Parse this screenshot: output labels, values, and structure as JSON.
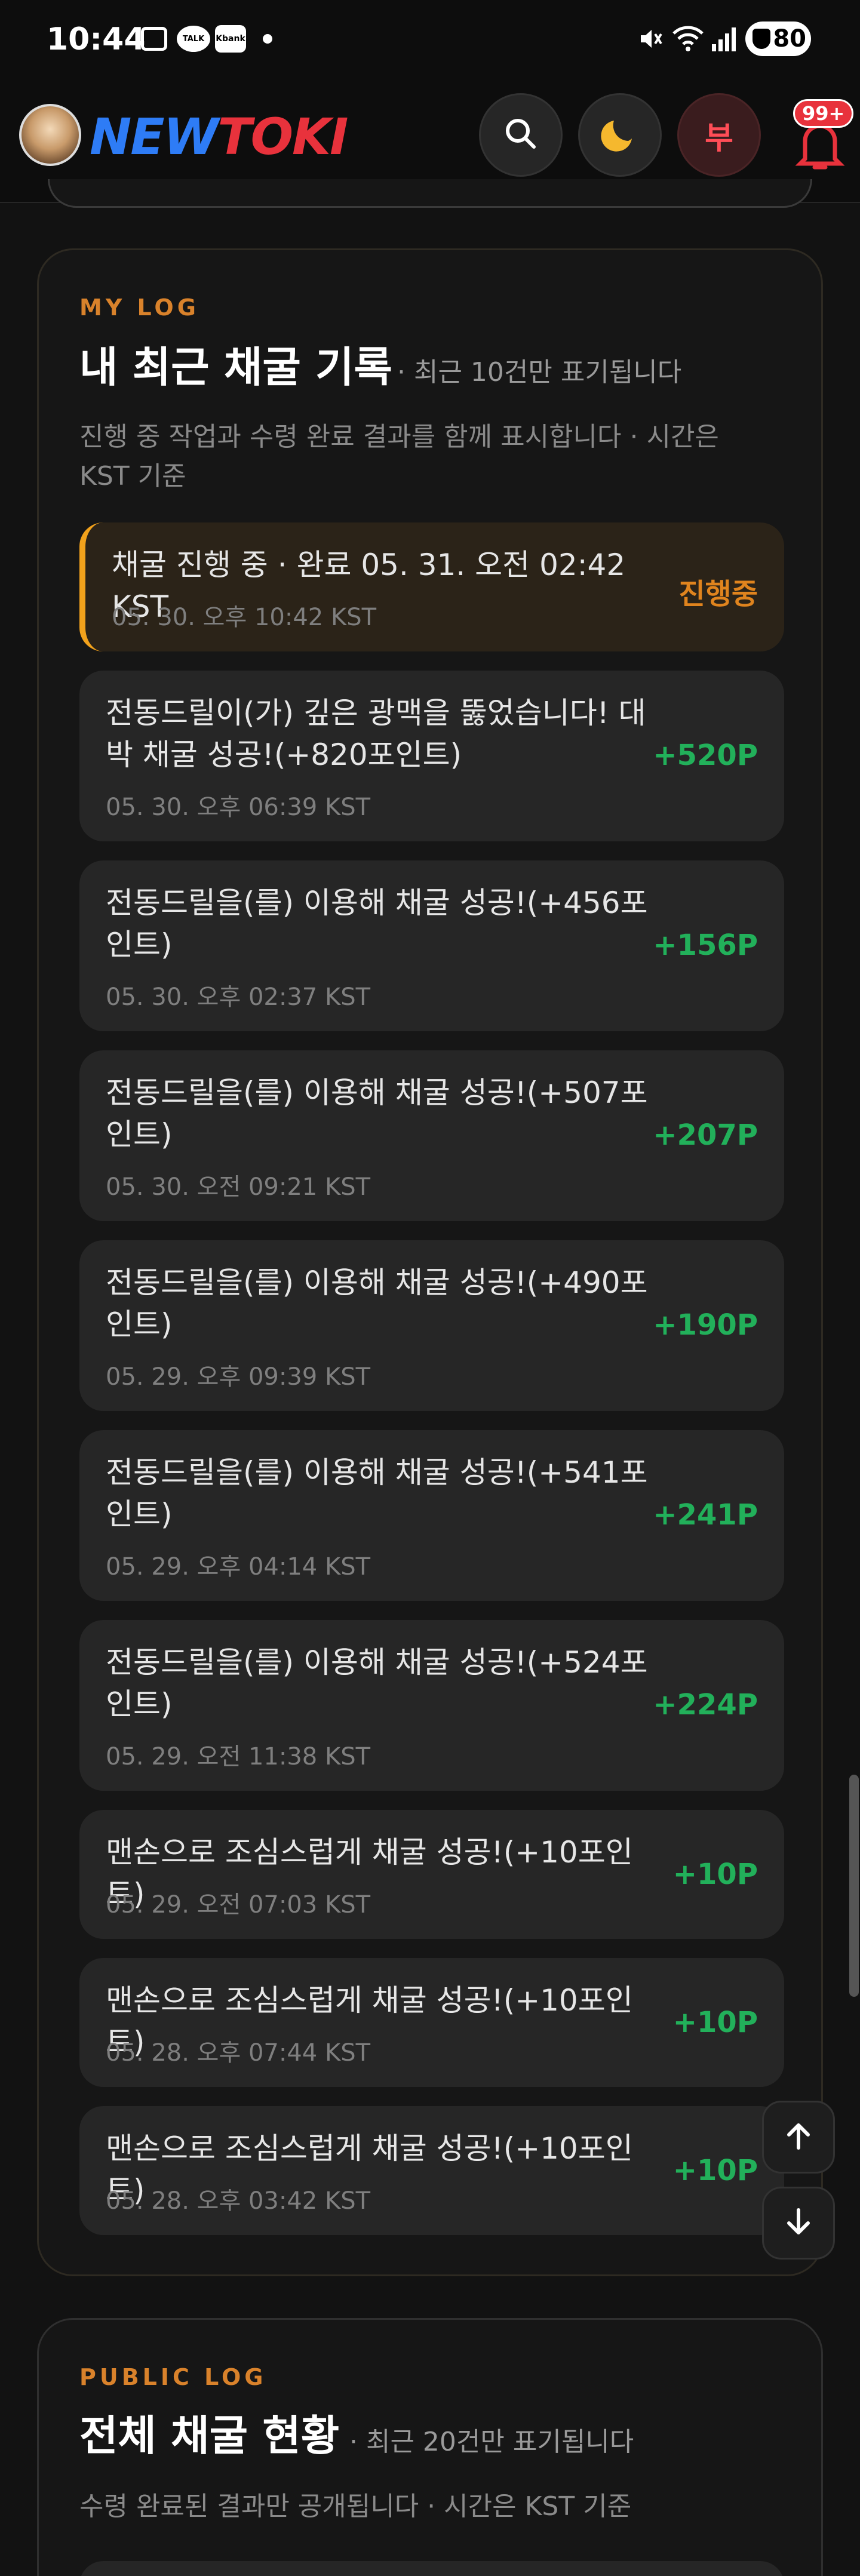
{
  "status_bar": {
    "time": "10:44",
    "icons": [
      "screenshot-icon",
      "talk-icon",
      "kbank-icon",
      "dot-icon",
      "mute-icon",
      "wifi-icon",
      "signal-icon"
    ],
    "talk_label": "TALK",
    "kbank_label": "Kbank",
    "battery": "80"
  },
  "header": {
    "logo_part1": "NEW",
    "logo_part2": "TOKI",
    "brand_colors": {
      "new": "#2e7cf6",
      "toki": "#e8323c"
    },
    "search_icon": "search-icon",
    "theme_icon": "moon-icon",
    "moon_color": "#f5b82e",
    "avatar_label": "부",
    "notification_badge": "99+"
  },
  "my_log": {
    "eyebrow": "MY LOG",
    "title": "내 최근 채굴 기록",
    "subtitle": "· 최근 10건만 표기됩니다",
    "description": "진행 중 작업과 수령 완료 결과를 함께 표시합니다 · 시간은 KST 기준",
    "accent_color": "#f2a21c",
    "items": [
      {
        "text": "채굴 진행 중 · 완료 05. 31. 오전 02:42 KST",
        "time": "05. 30. 오후 10:42 KST",
        "status": "진행중"
      },
      {
        "text": "전동드릴이(가) 깊은 광맥을 뚫었습니다! 대박 채굴 성공!(+820포인트)",
        "time": "05. 30. 오후 06:39 KST",
        "points": "+520P"
      },
      {
        "text": "전동드릴을(를) 이용해 채굴 성공!(+456포인트)",
        "time": "05. 30. 오후 02:37 KST",
        "points": "+156P"
      },
      {
        "text": "전동드릴을(를) 이용해 채굴 성공!(+507포인트)",
        "time": "05. 30. 오전 09:21 KST",
        "points": "+207P"
      },
      {
        "text": "전동드릴을(를) 이용해 채굴 성공!(+490포인트)",
        "time": "05. 29. 오후 09:39 KST",
        "points": "+190P"
      },
      {
        "text": "전동드릴을(를) 이용해 채굴 성공!(+541포인트)",
        "time": "05. 29. 오후 04:14 KST",
        "points": "+241P"
      },
      {
        "text": "전동드릴을(를) 이용해 채굴 성공!(+524포인트)",
        "time": "05. 29. 오전 11:38 KST",
        "points": "+224P"
      },
      {
        "text": "맨손으로 조심스럽게 채굴 성공!(+10포인트)",
        "time": "05. 29. 오전 07:03 KST",
        "points": "+10P"
      },
      {
        "text": "맨손으로 조심스럽게 채굴 성공!(+10포인트)",
        "time": "05. 28. 오후 07:44 KST",
        "points": "+10P"
      },
      {
        "text": "맨손으로 조심스럽게 채굴 성공!(+10포인트)",
        "time": "05. 28. 오후 03:42 KST",
        "points": "+10P"
      }
    ]
  },
  "public_log": {
    "eyebrow": "PUBLIC LOG",
    "title": "전체 채굴 현황",
    "subtitle": "· 최근 20건만 표기됩니다",
    "description": "수령 완료된 결과만 공개됩니다 · 시간은 KST 기준"
  },
  "fab": {
    "up_icon": "arrow-up-icon",
    "down_icon": "arrow-down-icon"
  }
}
